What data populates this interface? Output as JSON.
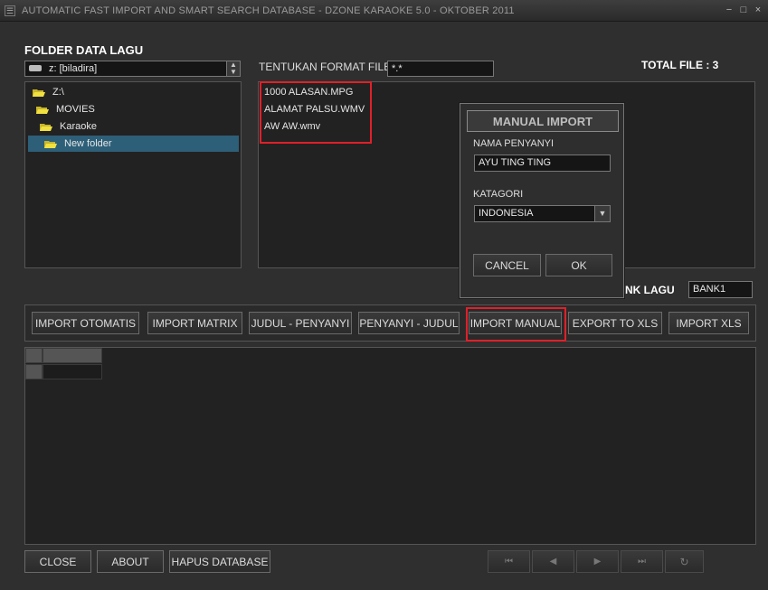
{
  "window": {
    "title": "AUTOMATIC FAST IMPORT AND SMART SEARCH DATABASE - DZONE KARAOKE 5.0 - OKTOBER 2011",
    "sysmenu_glyph": "☰",
    "minimize_glyph": "−",
    "restore_glyph": "□",
    "close_glyph": "×"
  },
  "folder_section": {
    "heading": "FOLDER DATA LAGU",
    "drive_value": "z: [biladira]",
    "tree": [
      {
        "label": "Z:\\",
        "selected": false
      },
      {
        "label": "MOVIES",
        "selected": false
      },
      {
        "label": "Karaoke",
        "selected": false
      },
      {
        "label": "New folder",
        "selected": true
      }
    ]
  },
  "format": {
    "label": "TENTUKAN FORMAT FILE",
    "value": "*.*"
  },
  "total_file": {
    "label": "TOTAL FILE : 3"
  },
  "files": [
    "1000 ALASAN.MPG",
    "ALAMAT PALSU.WMV",
    "AW AW.wmv"
  ],
  "bank": {
    "label": "NK LAGU",
    "value": "BANK1"
  },
  "dialog": {
    "title": "MANUAL IMPORT",
    "singer_label": "NAMA PENYANYI",
    "singer_value": "AYU TING TING",
    "category_label": "KATAGORI",
    "category_value": "INDONESIA",
    "cancel_label": "CANCEL",
    "ok_label": "OK"
  },
  "actions": {
    "import_otomatis": "IMPORT OTOMATIS",
    "import_matrix": "IMPORT MATRIX",
    "judul_penyanyi": "JUDUL - PENYANYI",
    "penyanyi_judul": "PENYANYI - JUDUL",
    "import_manual": "IMPORT MANUAL",
    "export_xls": "EXPORT TO XLS",
    "import_xls": "IMPORT XLS"
  },
  "footer": {
    "close": "CLOSE",
    "about": "ABOUT",
    "hapus_database": "HAPUS DATABASE"
  },
  "nav": {
    "first": "⏮",
    "prev": "◀",
    "next": "▶",
    "last": "⏭",
    "refresh": "↻"
  },
  "colors": {
    "highlight_red": "#e0202a",
    "selection": "#2d5f78",
    "folder": "#e8d83a"
  }
}
